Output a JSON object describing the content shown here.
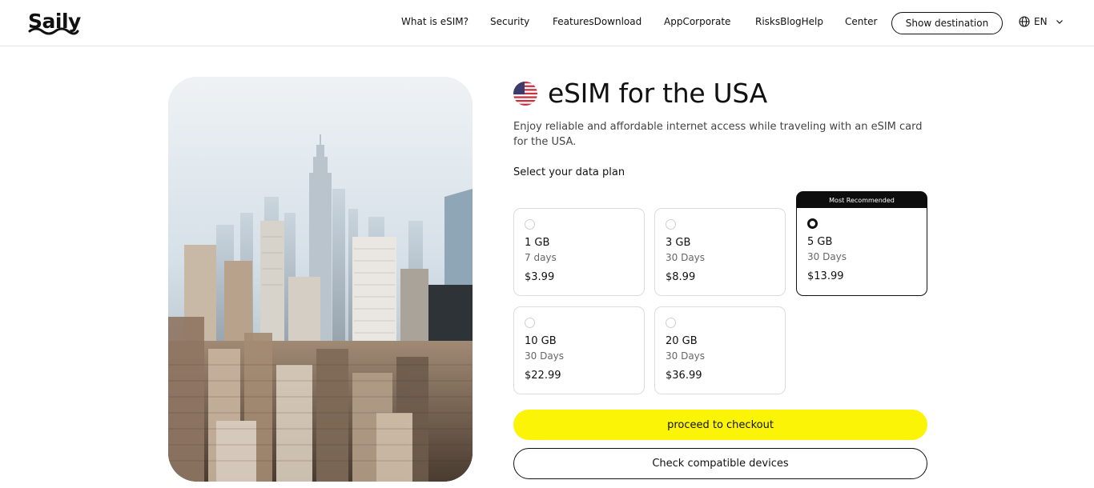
{
  "header": {
    "logo": "Saily",
    "nav": [
      "What is eSIM?",
      "Security",
      "FeaturesDownload",
      "AppCorporate",
      "RisksBlogHelp",
      "Center"
    ],
    "show_destination": "Show destination",
    "language": "EN",
    "icons": {
      "language": "globe-icon",
      "chevron": "chevron-down-icon"
    }
  },
  "hero": {
    "image": "city-skyline-photo"
  },
  "main": {
    "title": "eSIM for the USA",
    "flag": "usa-flag-icon",
    "subtitle": "Enjoy reliable and affordable internet access while traveling with an eSIM card for the USA.",
    "select_label": "Select your data plan",
    "badge": "Most Recommended",
    "plans": [
      {
        "data": "1 GB",
        "duration": "7 days",
        "price": "$3.99",
        "selected": false
      },
      {
        "data": "3 GB",
        "duration": "30 Days",
        "price": "$8.99",
        "selected": false
      },
      {
        "data": "5 GB",
        "duration": "30 Days",
        "price": "$13.99",
        "selected": true
      },
      {
        "data": "10 GB",
        "duration": "30 Days",
        "price": "$22.99",
        "selected": false
      },
      {
        "data": "20 GB",
        "duration": "30 Days",
        "price": "$36.99",
        "selected": false
      }
    ],
    "checkout_label": "proceed to checkout",
    "compatible_label": "Check compatible devices"
  },
  "colors": {
    "accent": "#fbf406",
    "text": "#111111",
    "border": "#dcdcdc"
  }
}
